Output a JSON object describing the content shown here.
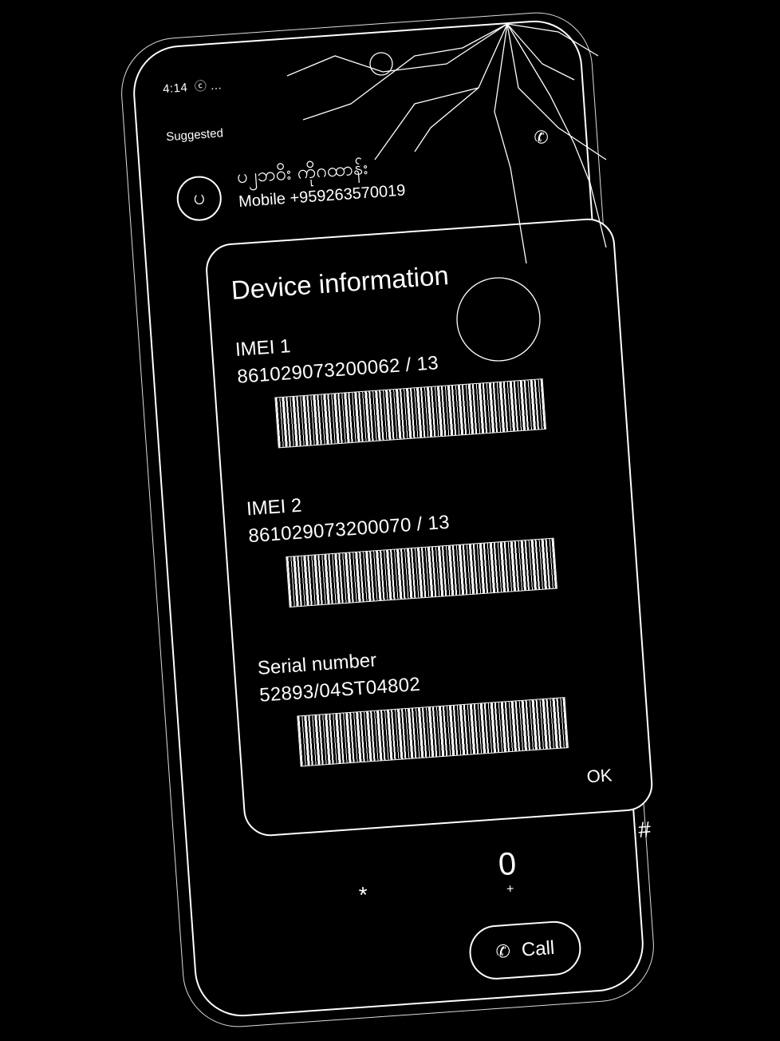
{
  "status_bar": {
    "time": "4:14",
    "icons": "ⓒ ..."
  },
  "suggested_label": "Suggested",
  "contact": {
    "avatar_letter": "ပ",
    "name": "ပ၂ဘ၀ိး ကိုဂထာန်း",
    "number": "Mobile +959263570019"
  },
  "dialog": {
    "title": "Device information",
    "imei1_label": "IMEI 1",
    "imei1_value": "861029073200062 / 13",
    "imei2_label": "IMEI 2",
    "imei2_value": "861029073200070 / 13",
    "serial_label": "Serial number",
    "serial_value": "52893/04ST04802",
    "ok_label": "OK"
  },
  "keypad": {
    "star": "*",
    "zero": "0",
    "plus": "+",
    "hash": "#"
  },
  "call_button": {
    "icon": "phone-icon",
    "label": "Call"
  }
}
